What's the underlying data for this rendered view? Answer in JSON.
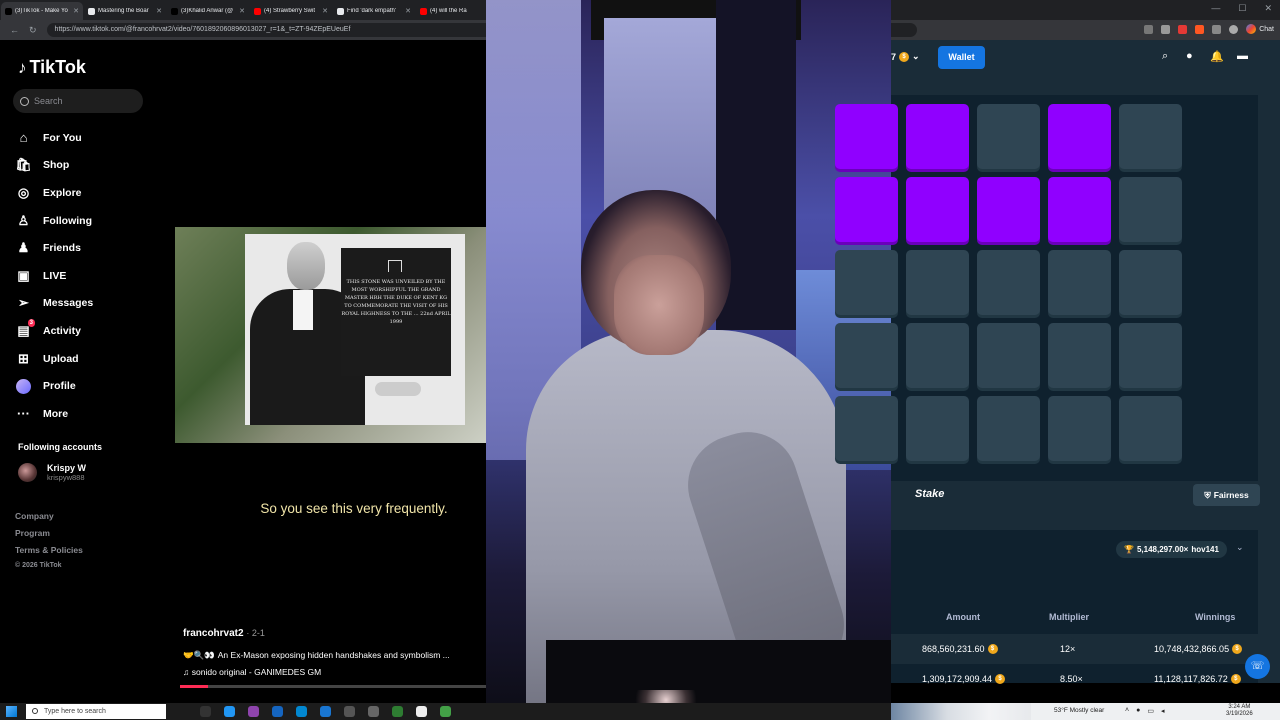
{
  "browser": {
    "tabs": [
      {
        "label": "(3)TikTok - Make Yo",
        "fav": "#000000"
      },
      {
        "label": "Mastering the Boar",
        "fav": "#e8eaed"
      },
      {
        "label": "(3)Khalid Anwar (@",
        "fav": "#000000"
      },
      {
        "label": "(4) Strawberry Swit",
        "fav": "#ff0000"
      },
      {
        "label": "Find 'dark empath'",
        "fav": "#e8eaed"
      },
      {
        "label": "(4) will the Ra",
        "fav": "#ff0000"
      }
    ],
    "url": "https://www.tiktok.com/@francohrvat2/video/7601892060896013027_r=1&_t=ZT-94ZEpEUeuEf",
    "chat_label": "Chat"
  },
  "tiktok": {
    "logo": "TikTok",
    "search_placeholder": "Search",
    "nav": [
      {
        "label": "For You",
        "icon": "home-icon"
      },
      {
        "label": "Shop",
        "icon": "shop-icon"
      },
      {
        "label": "Explore",
        "icon": "compass-icon"
      },
      {
        "label": "Following",
        "icon": "following-icon"
      },
      {
        "label": "Friends",
        "icon": "friends-icon"
      },
      {
        "label": "LIVE",
        "icon": "live-icon"
      },
      {
        "label": "Messages",
        "icon": "send-icon"
      },
      {
        "label": "Activity",
        "icon": "activity-icon",
        "badge": "3"
      },
      {
        "label": "Upload",
        "icon": "upload-icon"
      },
      {
        "label": "Profile",
        "icon": "profile-avatar-icon"
      },
      {
        "label": "More",
        "icon": "more-icon"
      }
    ],
    "following_title": "Following accounts",
    "following_account": {
      "name": "Krispy W",
      "handle": "krispyw888"
    },
    "footer": [
      "Company",
      "Program",
      "Terms & Policies"
    ],
    "copyright": "© 2026 TikTok",
    "video": {
      "plaque_text": "THIS STONE WAS UNVEILED BY THE MOST WORSHIPFUL THE GRAND MASTER HRH THE DUKE OF KENT KG TO COMMEMORATE THE VISIT OF HIS ROYAL HIGHNESS TO THE ... 22nd APRIL 1999",
      "caption": "So you see this very frequently.",
      "author": "francohrvat2",
      "date": "· 2-1",
      "description": "An Ex-Mason exposing hidden handshakes and symbolism ...",
      "sound": "sonido original - GANIMEDES GM"
    }
  },
  "stake": {
    "balance_suffix": "7",
    "wallet_label": "Wallet",
    "brand": "Stake",
    "fairness_label": "Fairness",
    "top_win": "5,148,297.00×",
    "top_win_user": "hov141",
    "table_headers": {
      "amount": "Amount",
      "multiplier": "Multiplier",
      "winnings": "Winnings"
    },
    "rows": [
      {
        "amount": "868,560,231.60",
        "multiplier": "12×",
        "winnings": "10,748,432,866.05"
      },
      {
        "amount": "1,309,172,909.44",
        "multiplier": "8.50×",
        "winnings": "11,128,117,826.72"
      }
    ],
    "grid_purple": [
      [
        1,
        0,
        1,
        0
      ],
      [
        1,
        1,
        1,
        0
      ],
      [
        0,
        0,
        0,
        0
      ],
      [
        0,
        0,
        0,
        0
      ],
      [
        0,
        0,
        0,
        0
      ]
    ],
    "colors": {
      "gem": "#9000ff",
      "tile": "#2f4553",
      "accent": "#1475e1"
    }
  },
  "taskbar": {
    "search_placeholder": "Type here to search",
    "weather": "53°F Mostly clear",
    "time": "3:24 AM",
    "date": "3/19/2026"
  }
}
